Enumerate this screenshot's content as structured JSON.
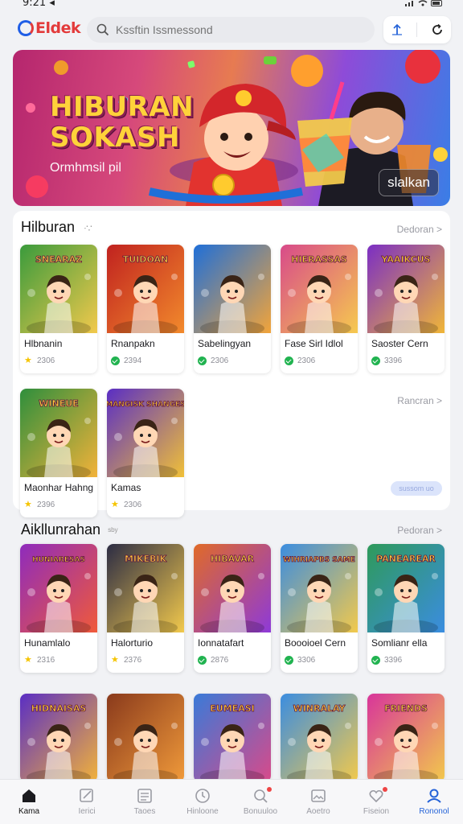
{
  "status": {
    "time": "9:21 ◂"
  },
  "brand": {
    "logo_text": "Eldek"
  },
  "search": {
    "placeholder": "Kssftin Issmessond"
  },
  "hero": {
    "title_line1": "HIBURAN",
    "title_line2": "SOKASH",
    "subtitle": "Ormhmsil pil",
    "badge": "slalkan"
  },
  "section1": {
    "title": "Hilburan",
    "title_suffix": "ᐧ∵",
    "more": "Dedoran >",
    "more2": "Rancran >",
    "button": "sussom uo",
    "cards": [
      {
        "title": "Hlbnanin",
        "rating": "2306",
        "badge": "star",
        "thumb_text": "SNEARAZ",
        "c1": "#3a9b3c",
        "c2": "#f2c94c"
      },
      {
        "title": "Rnanpakn",
        "rating": "2394",
        "badge": "ok",
        "thumb_text": "TUIDOAN",
        "c1": "#c0221f",
        "c2": "#f28a2c"
      },
      {
        "title": "Sabelingyan",
        "rating": "2306",
        "badge": "ok",
        "thumb_text": "",
        "c1": "#1f6fd8",
        "c2": "#f2a43a"
      },
      {
        "title": "Fase Sirl Idlol",
        "rating": "2306",
        "badge": "ok",
        "thumb_text": "HIERASSAS",
        "c1": "#d84a8a",
        "c2": "#f6c94f"
      },
      {
        "title": "Saoster Cern",
        "rating": "3396",
        "badge": "ok",
        "thumb_text": "YAAIKCUS",
        "c1": "#7b2ec4",
        "c2": "#f0b638"
      },
      {
        "title": "Maonhar Hahng",
        "rating": "2396",
        "badge": "star",
        "thumb_text": "WINEUE",
        "c1": "#2e8f3c",
        "c2": "#f2b23a"
      },
      {
        "title": "Kamas",
        "rating": "2306",
        "badge": "star",
        "thumb_text": "MANGISK SHANGES",
        "c1": "#5a2ec4",
        "c2": "#f0c038"
      }
    ]
  },
  "section2": {
    "title": "Aikllunrahan",
    "title_suffix": "ˢᵇʸ",
    "more": "Pedoran >",
    "cards": [
      {
        "title": "Hunamlalo",
        "rating": "2316",
        "badge": "star",
        "thumb_text": "HUNIARESAS",
        "c1": "#8e2bbd",
        "c2": "#f05a3a"
      },
      {
        "title": "Halorturio",
        "rating": "2376",
        "badge": "star",
        "thumb_text": "MIKEBIK",
        "c1": "#2c2c44",
        "c2": "#f2c94c"
      },
      {
        "title": "Ionnatafart",
        "rating": "2876",
        "badge": "ok",
        "thumb_text": "HIBAVAR",
        "c1": "#e06a28",
        "c2": "#8e3ad8"
      },
      {
        "title": "Boooioel Cern",
        "rating": "3306",
        "badge": "ok",
        "thumb_text": "WIHRIAPBS SAME",
        "c1": "#3b8de0",
        "c2": "#f2c94c"
      },
      {
        "title": "Somlianr ella",
        "rating": "3396",
        "badge": "ok",
        "thumb_text": "PANEAREAR",
        "c1": "#2e9a5a",
        "c2": "#3b8de0"
      }
    ]
  },
  "section3": {
    "cards": [
      {
        "thumb_text": "HIDNAISAS",
        "c1": "#5a2ec4",
        "c2": "#f2b23a"
      },
      {
        "thumb_text": "",
        "c1": "#8a3a1c",
        "c2": "#f09a3a"
      },
      {
        "thumb_text": "EUMEASI",
        "c1": "#3a7ad8",
        "c2": "#d84a8a"
      },
      {
        "thumb_text": "WINRALAY",
        "c1": "#3b8de0",
        "c2": "#f2c94c"
      },
      {
        "thumb_text": "FRIENDS",
        "c1": "#d8359a",
        "c2": "#f2c94c"
      }
    ]
  },
  "nav": [
    {
      "label": "Kama",
      "icon": "home-icon"
    },
    {
      "label": "Ierici",
      "icon": "edit-icon"
    },
    {
      "label": "Taoes",
      "icon": "list-icon"
    },
    {
      "label": "Hinloone",
      "icon": "clock-icon"
    },
    {
      "label": "Bonuuloo",
      "icon": "search-icon"
    },
    {
      "label": "Aoetro",
      "icon": "image-icon"
    },
    {
      "label": "Fiseion",
      "icon": "heart-icon"
    },
    {
      "label": "Rononol",
      "icon": "user-icon"
    }
  ],
  "colors": {
    "accent": "#2563d8",
    "brand_red": "#e33b3b",
    "star": "#f5c400",
    "ok": "#21b350"
  }
}
